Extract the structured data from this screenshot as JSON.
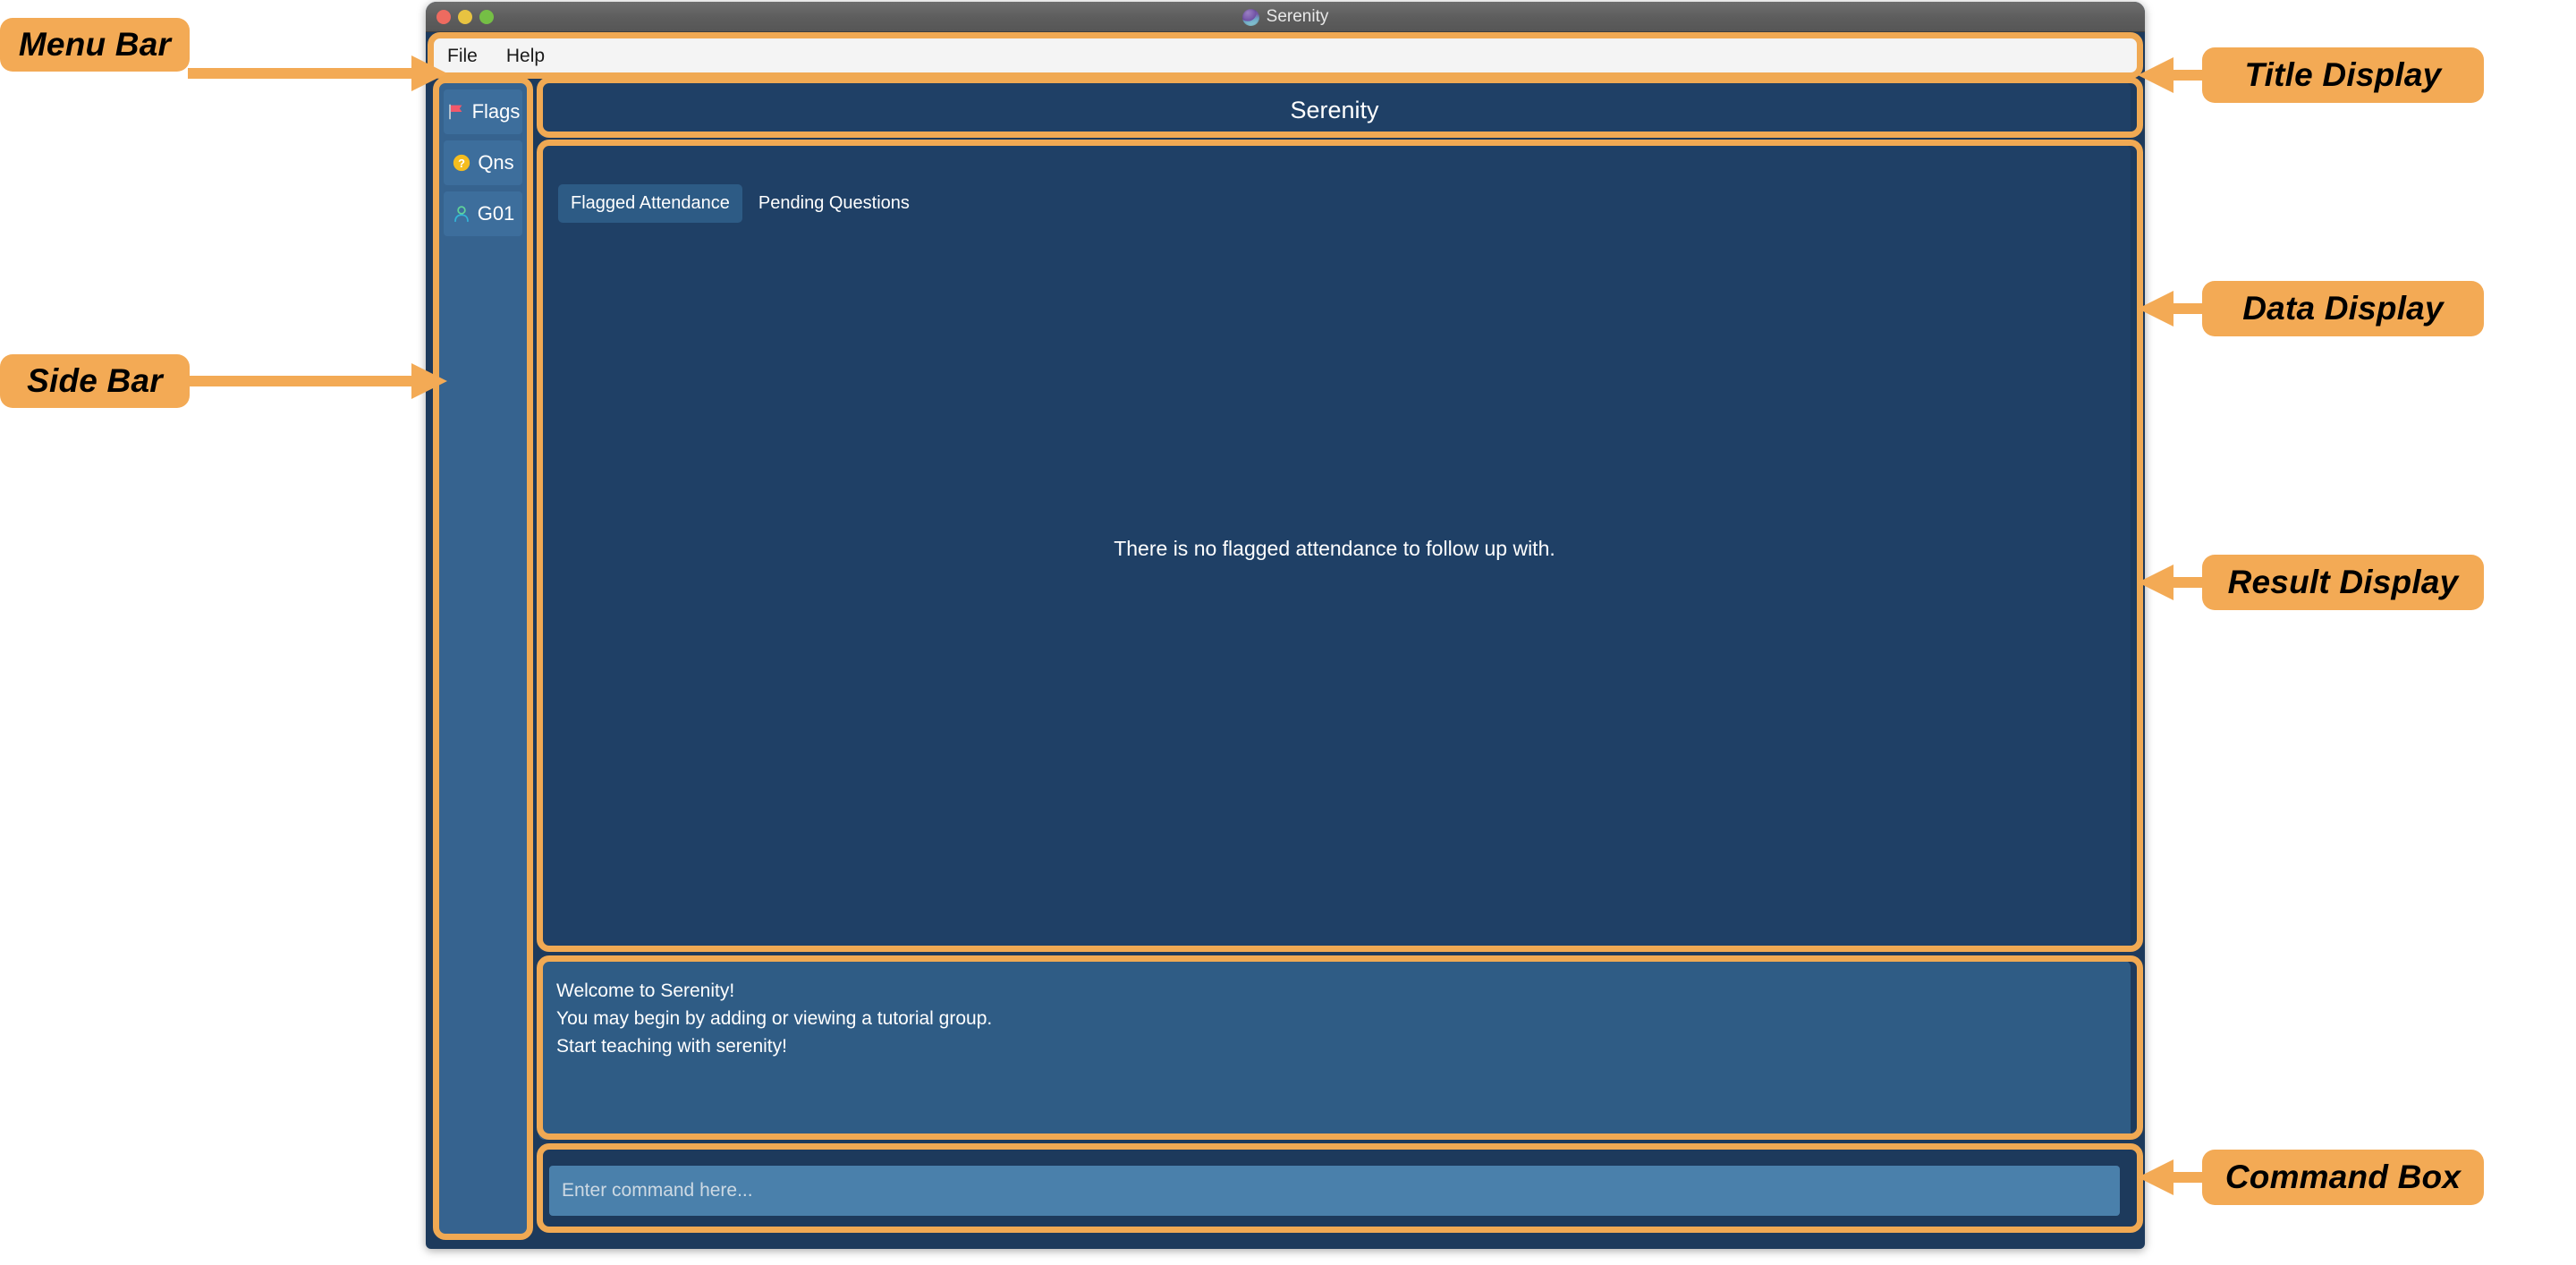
{
  "window": {
    "title": "Serenity",
    "logo_icon": "serenity-logo",
    "traffic_lights": [
      {
        "name": "close",
        "color": "#ee6b60"
      },
      {
        "name": "minimize",
        "color": "#e8c341"
      },
      {
        "name": "maximize",
        "color": "#75bf45"
      }
    ]
  },
  "menubar": {
    "items": [
      {
        "label": "File"
      },
      {
        "label": "Help"
      }
    ]
  },
  "sidebar": {
    "items": [
      {
        "label": "Flags",
        "icon": "red-flag-icon"
      },
      {
        "label": "Qns",
        "icon": "question-mark-circle-icon"
      },
      {
        "label": "G01",
        "icon": "person-icon"
      }
    ]
  },
  "title_display": {
    "text": "Serenity"
  },
  "data_display": {
    "tabs": [
      {
        "label": "Flagged Attendance",
        "active": true
      },
      {
        "label": "Pending Questions",
        "active": false
      }
    ],
    "empty_message": "There is no flagged attendance to follow up with."
  },
  "result_display": {
    "lines": [
      "Welcome to Serenity!",
      "You may begin by adding or viewing a tutorial group.",
      "Start teaching with serenity!"
    ]
  },
  "command_box": {
    "placeholder": "Enter command here...",
    "value": ""
  },
  "annotations": [
    {
      "id": "menu-bar",
      "label": "Menu Bar",
      "side": "left"
    },
    {
      "id": "side-bar",
      "label": "Side Bar",
      "side": "left"
    },
    {
      "id": "title-display",
      "label": "Title Display",
      "side": "right"
    },
    {
      "id": "data-display",
      "label": "Data Display",
      "side": "right"
    },
    {
      "id": "result-display",
      "label": "Result Display",
      "side": "right"
    },
    {
      "id": "command-box",
      "label": "Command Box",
      "side": "right"
    }
  ],
  "colors": {
    "annotation_fill": "#f3aa55",
    "highlight_border": "#f0a953",
    "window_bg": "#1d3a5c",
    "panel_bg": "#1f4066",
    "sidebar_bg": "#36638f",
    "result_bg": "#2f5c85",
    "command_bg": "#4a80ab"
  }
}
